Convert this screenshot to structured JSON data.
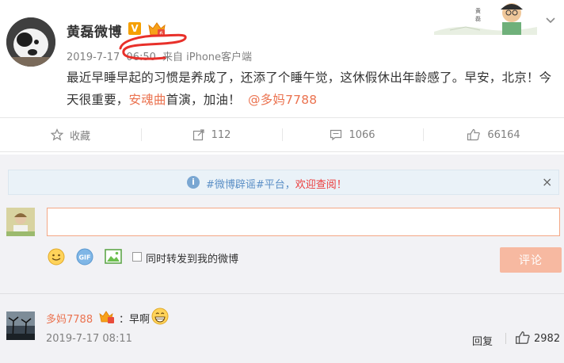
{
  "post": {
    "username": "黄磊微博",
    "verified_badge": "V",
    "date": "2019-7-17",
    "time": "06:50",
    "source": "来自 iPhone客户端",
    "text_part1": "最近早睡早起的习惯是养成了，还添了个睡午觉，这休假休出年龄感了。早安，北京！今天很重要，",
    "text_link": "安魂曲",
    "text_part2": "首演，加油！",
    "mention": "@多妈7788"
  },
  "actions": {
    "favorite": "收藏",
    "repost_count": "112",
    "comment_count": "1066",
    "like_count": "66164"
  },
  "notice": {
    "prefix": "#微博辟谣#平台，",
    "highlight": "欢迎查阅！",
    "close": "×"
  },
  "composer": {
    "input_value": "",
    "repost_label": "同时转发到我的微博",
    "submit_label": "评论"
  },
  "comments": [
    {
      "user": "多妈7788",
      "text": "：早啊",
      "time": "2019-7-17 08:11",
      "reply_label": "回复",
      "likes": "2982"
    }
  ],
  "colors": {
    "accent": "#eb7350",
    "notice_text": "#5b8fc6",
    "notice_highlight": "#eb3c3c",
    "submit_bg": "#f7b9a1",
    "annotation": "#e8302a"
  }
}
